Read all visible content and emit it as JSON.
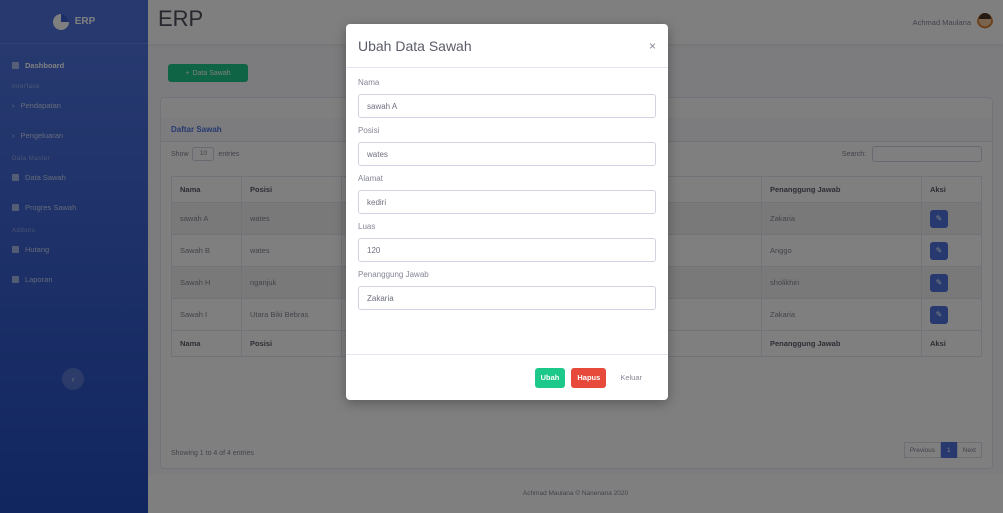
{
  "sidebar": {
    "brand": "ERP",
    "dashboard": "Dashboard",
    "heading1": "Interface",
    "item1": "Pendapatan",
    "item2": "Pengeluaran",
    "heading2": "Data Master",
    "item3": "Data Sawah",
    "item4": "Progres Sawah",
    "heading3": "Addons",
    "item5": "Hutang",
    "item6": "Laporan",
    "toggle_icon": "chevron-left-icon"
  },
  "topbar": {
    "title": "ERP",
    "user_name": "Achmad Maulana"
  },
  "content": {
    "add_button": "Data Sawah",
    "card_title": "Daftar Sawah",
    "show_label": "Show",
    "entries_label": "entries",
    "entries_value": "10",
    "search_label": "Search:",
    "columns": [
      "Nama",
      "Posisi",
      "",
      "Penanggung Jawab",
      "Aksi"
    ],
    "rows": [
      {
        "nama": "sawah A",
        "posisi": "wates",
        "pj": "Zakaria"
      },
      {
        "nama": "Sawah B",
        "posisi": "wates",
        "pj": "Anggo"
      },
      {
        "nama": "Sawah H",
        "posisi": "nganjuk",
        "pj": "sholikhin"
      },
      {
        "nama": "Sawah I",
        "posisi": "Utara Biki Bebras",
        "pj": "Zakaria"
      }
    ],
    "info": "Showing 1 to 4 of 4 entries",
    "prev": "Previous",
    "page": "1",
    "next": "Next"
  },
  "footer": {
    "text": "Achmad Maulana © Nanenana 2020"
  },
  "modal": {
    "title": "Ubah Data Sawah",
    "close": "×",
    "fields": {
      "nama_label": "Nama",
      "nama_value": "sawah A",
      "posisi_label": "Posisi",
      "posisi_value": "wates",
      "alamat_label": "Alamat",
      "alamat_value": "kediri",
      "luas_label": "Luas",
      "luas_value": "120",
      "pj_label": "Penanggung Jawab",
      "pj_value": "Zakaria"
    },
    "buttons": {
      "ubah": "Ubah",
      "hapus": "Hapus",
      "keluar": "Keluar"
    }
  },
  "colors": {
    "primary": "#4e73df",
    "success": "#1cc88a",
    "danger": "#e74a3b"
  }
}
